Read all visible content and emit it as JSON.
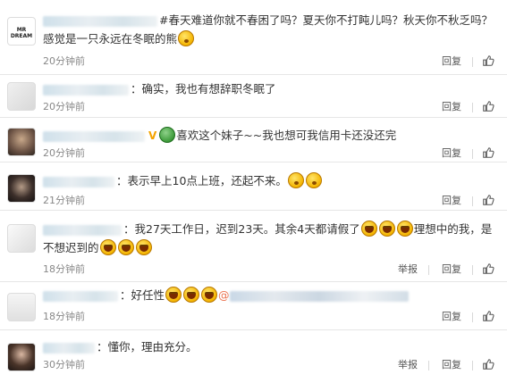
{
  "comments": [
    {
      "text": "#春天难道你就不春困了吗？夏天你不打盹儿吗？秋天你不秋乏吗？感觉是一只永远在冬眠的熊",
      "time": "20分钟前",
      "reply": "回复",
      "avatar_label": "MR DREAM"
    },
    {
      "text": "：确实，我也有想辞职冬眠了",
      "time": "20分钟前",
      "reply": "回复"
    },
    {
      "badge": "V",
      "text": "喜欢这个妹子~~我也想可我信用卡还没还完",
      "time": "20分钟前",
      "reply": "回复"
    },
    {
      "text": "：表示早上10点上班，还起不来。",
      "time": "21分钟前",
      "reply": "回复"
    },
    {
      "text_1": "：我27天工作日，迟到23天。其余4天都请假了",
      "text_2": "理想中的我，是不想迟到的",
      "time": "18分钟前",
      "report": "举报",
      "reply": "回复"
    },
    {
      "text": "：好任性",
      "mention_prefix": "@",
      "time": "18分钟前",
      "reply": "回复"
    },
    {
      "text": "：懂你，理由充分。",
      "time": "30分钟前",
      "report": "举报",
      "reply": "回复"
    }
  ],
  "icons": {
    "like": "thumbs-up-icon",
    "emoji": "laughing-face-emoji"
  },
  "colors": {
    "link": "#eb7350",
    "meta": "#888888",
    "divider": "#e6e6e6"
  }
}
